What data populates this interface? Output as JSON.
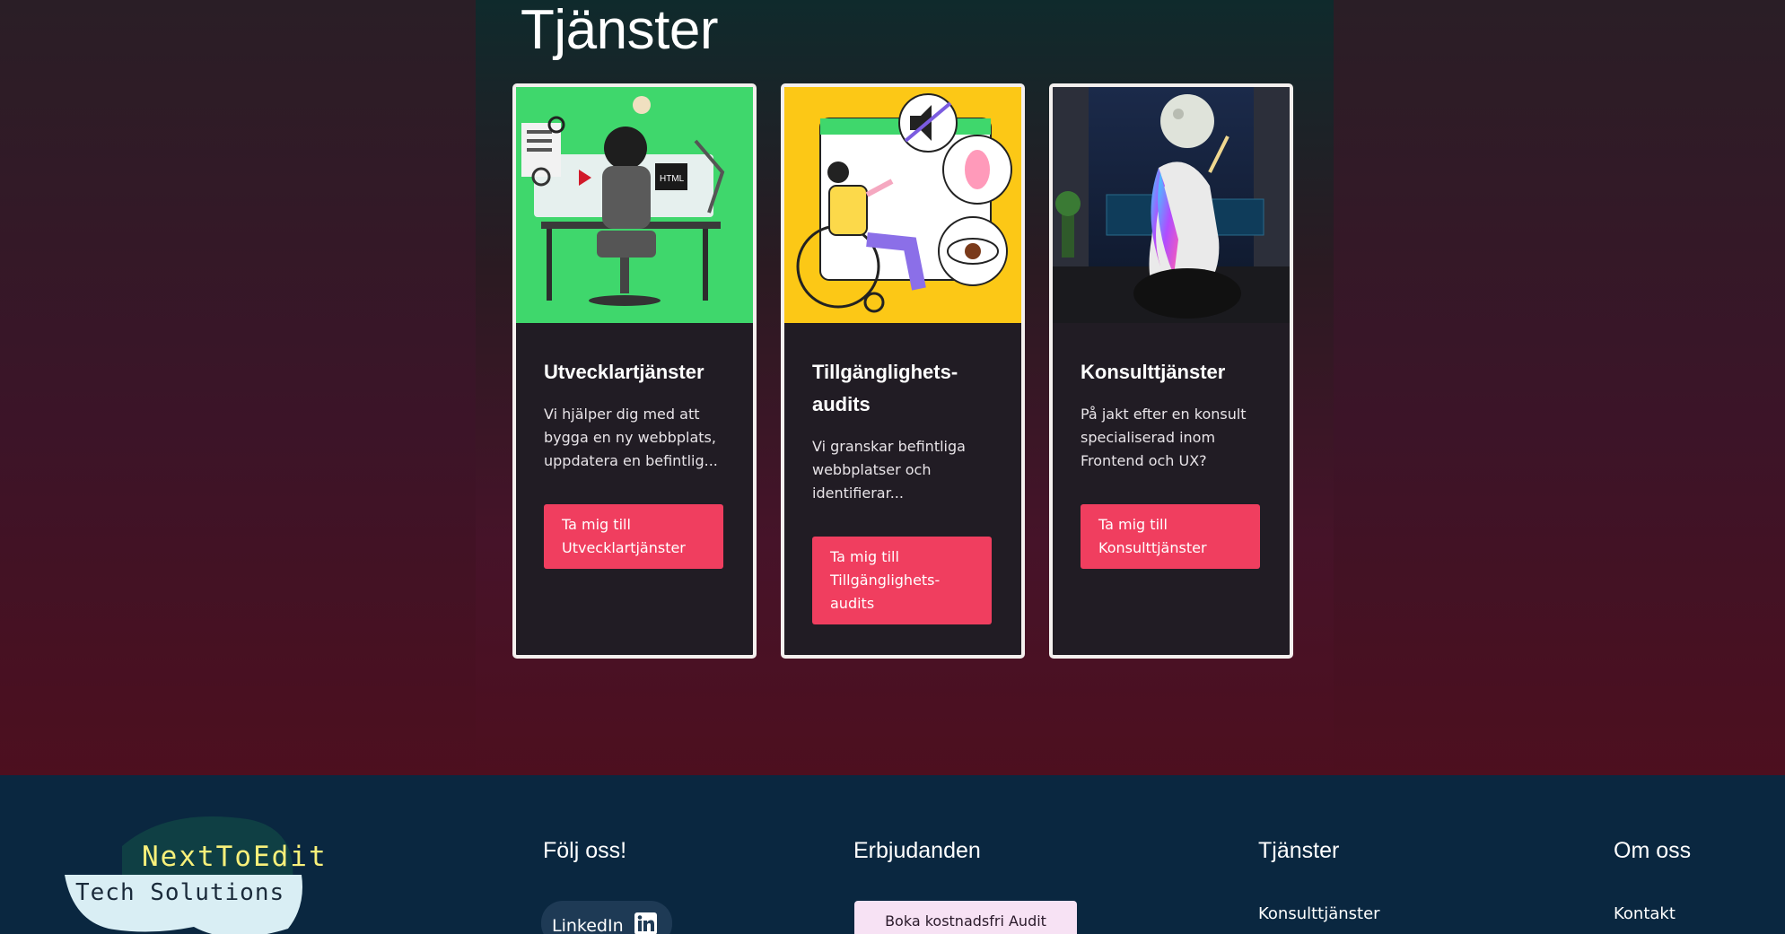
{
  "services": {
    "title": "Tjänster",
    "cards": [
      {
        "title": "Utvecklartjänster",
        "description": "Vi hjälper dig med att bygga en ny webbplats, uppdatera en befintlig...",
        "button": "Ta mig till Utvecklartjänster"
      },
      {
        "title": "Tillgänglighets-audits",
        "description": "Vi granskar befintliga webbplatser och identifierar...",
        "button": "Ta mig till Tillgänglighets-audits"
      },
      {
        "title": "Konsulttjänster",
        "description": "På jakt efter en konsult specialiserad inom Frontend och UX?",
        "button": "Ta mig till Konsulttjänster"
      }
    ]
  },
  "footer": {
    "logo_line1": "NextToEdit",
    "logo_line2": "Tech Solutions",
    "follow": {
      "heading": "Följ oss!",
      "linkedin": "LinkedIn"
    },
    "offers": {
      "heading": "Erbjudanden",
      "button": "Boka kostnadsfri Audit"
    },
    "services": {
      "heading": "Tjänster",
      "link": "Konsulttjänster"
    },
    "about": {
      "heading": "Om oss",
      "link": "Kontakt"
    }
  },
  "colors": {
    "accent": "#f03e5f",
    "footer_bg": "#0a2740",
    "card_bg": "#211c24"
  }
}
